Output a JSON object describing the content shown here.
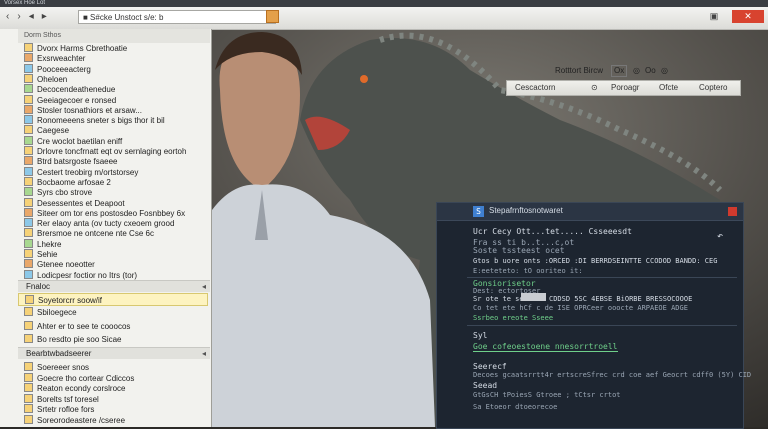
{
  "window": {
    "title": "Vorsex Hoe Lot",
    "address": "■ S#cke Unstoct s/e: b"
  },
  "nav": [
    "‹",
    "›",
    "◂",
    "▸"
  ],
  "left_panel": {
    "header": "Dorm Sthos",
    "rows": [
      "Dvorx Harms Cbrethoatie",
      "Exsrweachter",
      "Pooceeeacterg",
      "Oheloen",
      "Decocendeathenedue",
      "Geeiagecoer e ronsed",
      "Stosler tosnathiors et arsaw...",
      "Ronomeeens sneter s bigs thor it bil",
      "Caegese",
      "Cre woclot baetilan eniff",
      "Drlovre toncfrnatt eqt ov sernlaging eortoh",
      "Btrd batsrgoste fsaeee",
      "Cestert treobirg m/ortstorsey",
      "Bocbaome arfosae 2",
      "Syrs cbo strove",
      "Desessentes et Deapoot",
      "Siteer om tor ens postosdeo Fosnbbey 6x",
      "Rer elaoy anta (ov tucty cxeoem grood",
      "Brersmoe ne ontcene nte Cse 6c",
      "Lhekre",
      "Sehie",
      "Gtenee noeotter",
      "Lodicpesr foctior no Itrs (tor)"
    ],
    "section1": "Fnaloc",
    "row_a": "Soyetorcrr soow/if",
    "row_b": "Sbiloegece",
    "row_c": "Ahter er to see te cooocos",
    "row_d": "Bo resdto pie soo Sicae",
    "section2": "Bearbtwbadseerer",
    "rows2": [
      "Soereeer snos",
      "Goecre tho cortear Cdiccos",
      "Reaton econdy corslroce",
      "Borelts tsf toresel",
      "Srtetr rofloe fors",
      "Soreorodeastere /cseree"
    ]
  },
  "right_toolbar": {
    "items": [
      "Rotttort Bircw",
      "Ox",
      "◎",
      "Oo",
      "◎"
    ],
    "items2": [
      "Cescactorn",
      "⊙",
      "Poroagr",
      "Ofcte",
      "Coptero"
    ]
  },
  "dialog": {
    "title": "Stepafrnftosnotwaret",
    "lines": {
      "l1": "Ucr Cecy  Ott...tet.....  Csseeesdt",
      "l2": "Fra  ss  ti b..t...c,ot",
      "l3": "Soste tssteest ocet",
      "l4": "Gtos  b  uore onts  :ORCED :DI   BERRDSEINTTE  CCODOD BANDD: CEG",
      "l5": "E:eeteteto:   tO   ooriteo  it:",
      "l6": "Gonsiorisetor",
      "l7": "Dest: ectortoser",
      "l8a": "Sr ote te    sess",
      "l8b": "CDDSD  5SC  4EBSE  BiORBE   BRESSOCOOOE",
      "l9": "Co tet ete hCf  c de ISE OPRCeer  ooocte  ARPAEOE ADGE",
      "l10": "Ssrbeo ereote  Sseee",
      "l11": "Syl",
      "l12": "Goe cofeoestoene    nnesorrtroell",
      "l13": "Seerecf",
      "l14": "Decoes gcaatsrrtt4r ertscreSfrec crd coe aef  Geocrt  cdff0 (5Y)  CID",
      "l15": "Seead",
      "l16": "GtGsCH tPoiesS  Gtroee ;  tCtsr   crtot",
      "l17": "Sa  Etoeor  dtoeorecoe"
    },
    "close_icon": "close-icon",
    "undo_icon": "undo-icon"
  },
  "colors": {
    "accent": "#d8432f",
    "dialog_bg": "#1d2530",
    "green_text": "#6fd08a"
  }
}
